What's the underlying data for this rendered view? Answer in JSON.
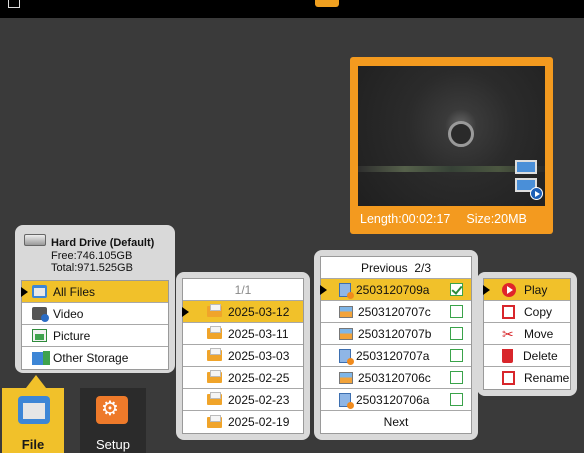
{
  "preview": {
    "length": "Length:00:02:17",
    "size": "Size:20MB"
  },
  "storage": {
    "drive_name": "Hard Drive (Default)",
    "free": "Free:746.105GB",
    "total": "Total:971.525GB",
    "items": [
      {
        "label": "All Files",
        "icon": "all-files-icon"
      },
      {
        "label": "Video",
        "icon": "video-icon"
      },
      {
        "label": "Picture",
        "icon": "picture-icon"
      },
      {
        "label": "Other Storage",
        "icon": "other-storage-icon"
      }
    ],
    "selected": "All Files"
  },
  "dates": {
    "page": "1/1",
    "items": [
      "2025-03-12",
      "2025-03-11",
      "2025-03-03",
      "2025-02-25",
      "2025-02-23",
      "2025-02-19"
    ],
    "selected": "2025-03-12"
  },
  "files": {
    "prev_label": "Previous",
    "page": "2/3",
    "next_label": "Next",
    "items": [
      {
        "name": "2503120709a",
        "type": "video",
        "checked": true
      },
      {
        "name": "2503120707c",
        "type": "image",
        "checked": false
      },
      {
        "name": "2503120707b",
        "type": "image",
        "checked": false
      },
      {
        "name": "2503120707a",
        "type": "video",
        "checked": false
      },
      {
        "name": "2503120706c",
        "type": "image",
        "checked": false
      },
      {
        "name": "2503120706a",
        "type": "video",
        "checked": false
      }
    ],
    "selected": "2503120709a"
  },
  "actions": {
    "items": [
      {
        "label": "Play",
        "icon": "play-icon"
      },
      {
        "label": "Copy",
        "icon": "copy-icon"
      },
      {
        "label": "Move",
        "icon": "scissors-icon"
      },
      {
        "label": "Delete",
        "icon": "trash-icon"
      },
      {
        "label": "Rename",
        "icon": "rename-icon"
      }
    ],
    "selected": "Play"
  },
  "tabs": {
    "file_label": "File",
    "setup_label": "Setup"
  },
  "colors": {
    "accent": "#f1c12a",
    "preview_frame": "#f39a1f",
    "background": "#3a3a3a"
  }
}
